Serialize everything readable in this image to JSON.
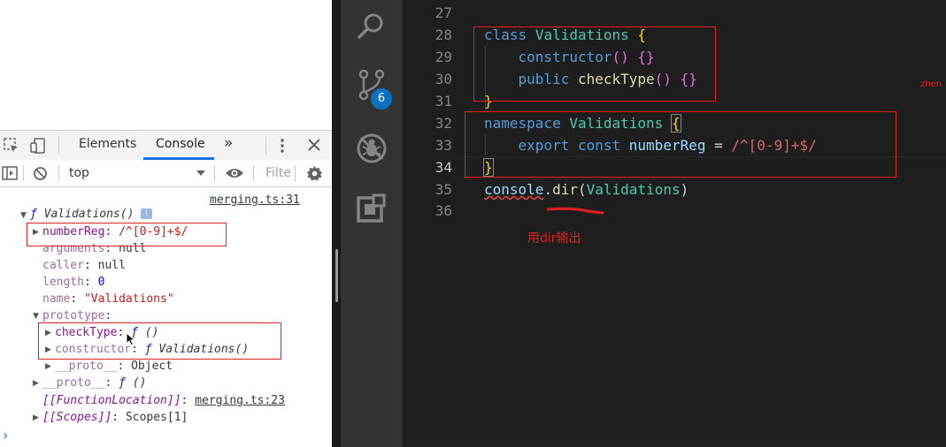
{
  "devtools": {
    "tabs": [
      "Elements",
      "Console"
    ],
    "more_tabs": "»",
    "context": "top",
    "filter_placeholder": "Filte",
    "source_link": "merging.ts:31",
    "tree": {
      "root_label": "Validations()",
      "f_symbol": "ƒ",
      "numberReg_key": "numberReg",
      "numberReg_val": "/^[0-9]+$/",
      "arguments_key": "arguments",
      "arguments_val": "null",
      "caller_key": "caller",
      "caller_val": "null",
      "length_key": "length",
      "length_val": "0",
      "name_key": "name",
      "name_val": "\"Validations\"",
      "prototype_key": "prototype",
      "checkType_key": "checkType",
      "checkType_val": "()",
      "constructor_key": "constructor",
      "constructor_val": "Validations()",
      "proto_key": "__proto__",
      "proto_obj_val": "Object",
      "proto_fn_val": "()",
      "function_location_key": "[[FunctionLocation]]",
      "function_location_val": "merging.ts:23",
      "scopes_key": "[[Scopes]]",
      "scopes_val": "Scopes[1]"
    },
    "prompt_symbol": "›"
  },
  "editor": {
    "lines": [
      {
        "num": "27"
      },
      {
        "num": "28"
      },
      {
        "num": "29"
      },
      {
        "num": "30"
      },
      {
        "num": "31"
      },
      {
        "num": "32"
      },
      {
        "num": "33"
      },
      {
        "num": "34"
      },
      {
        "num": "35"
      },
      {
        "num": "36"
      }
    ],
    "tokens": {
      "class": "class",
      "validations": "Validations",
      "open_brace": "{",
      "close_brace": "}",
      "constructor": "constructor",
      "parens": "()",
      "empty_braces": "{}",
      "public": "public",
      "checkType": "checkType",
      "namespace": "namespace",
      "export": "export",
      "const": "const",
      "numberReg": "numberReg",
      "eq": "=",
      "regex": "/^[0-9]+$/",
      "console": "console",
      "dot": ".",
      "dir": "dir",
      "lparen": "(",
      "rparen": ")"
    },
    "annotation": "用dir输出",
    "edge_text": "zhen"
  },
  "activity_bar": {
    "icons": [
      "search-icon",
      "source-control-icon",
      "debug-icon",
      "extensions-icon"
    ],
    "badge_count": "6"
  },
  "colors": {
    "annotation_red": "#e02020",
    "vscode_bg": "#1e1e1e",
    "activity_bg": "#333333"
  }
}
